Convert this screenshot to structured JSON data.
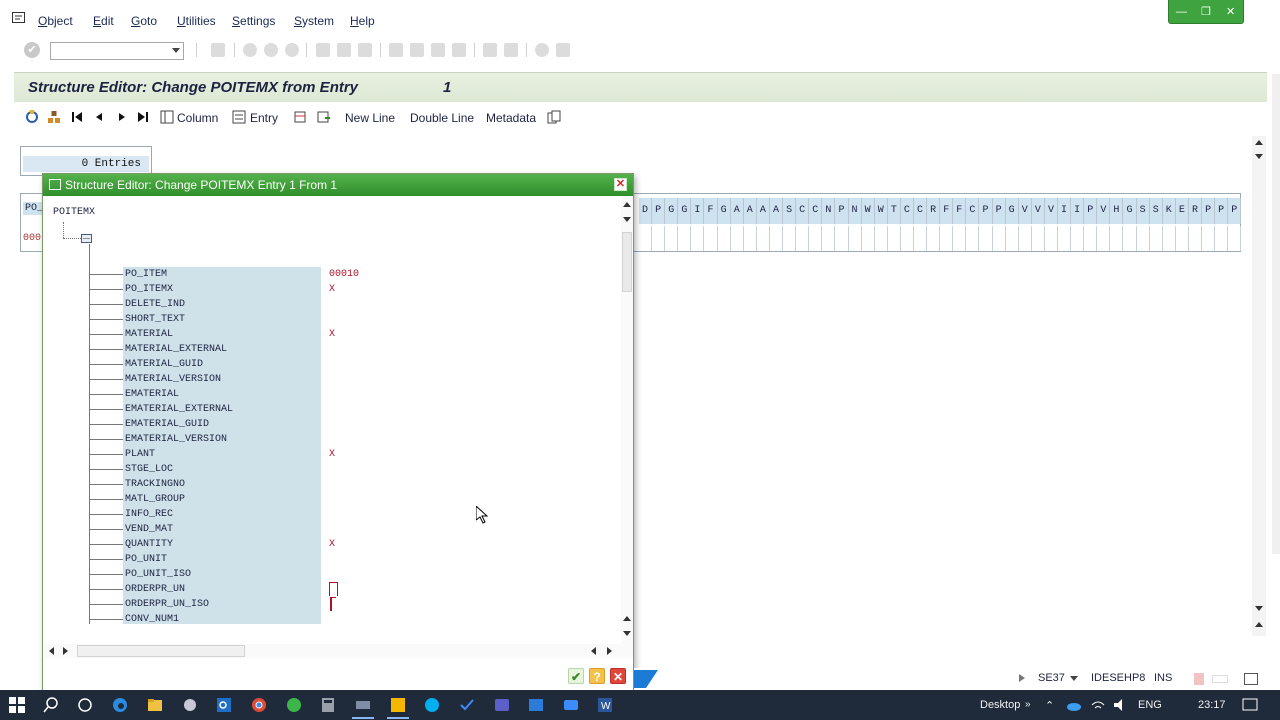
{
  "menu": {
    "items": [
      "Object",
      "Edit",
      "Goto",
      "Utilities",
      "Settings",
      "System",
      "Help"
    ]
  },
  "screen": {
    "title": "Structure Editor: Change POITEMX from Entry",
    "entry_number": "1"
  },
  "app_toolbar": {
    "column_label": "Column",
    "entry_label": "Entry",
    "new_line_label": "New Line",
    "double_line_label": "Double Line",
    "metadata_label": "Metadata"
  },
  "background_table": {
    "entries_text": "0 Entries",
    "first_header_fragment": "PO_",
    "first_value_fragment": "000",
    "column_letters": [
      "D",
      "P",
      "G",
      "G",
      "I",
      "F",
      "G",
      "A",
      "A",
      "A",
      "A",
      "S",
      "C",
      "C",
      "N",
      "P",
      "N",
      "W",
      "W",
      "T",
      "C",
      "C",
      "R",
      "F",
      "F",
      "C",
      "P",
      "P",
      "G",
      "V",
      "V",
      "V",
      "I",
      "I",
      "P",
      "V",
      "H",
      "G",
      "S",
      "S",
      "K",
      "E",
      "R",
      "P",
      "P",
      "P"
    ]
  },
  "dialog": {
    "title": "Structure Editor: Change POITEMX Entry 1 From 1",
    "root_label": "POITEMX",
    "fields": [
      {
        "name": "PO_ITEM",
        "value": "00010"
      },
      {
        "name": "PO_ITEMX",
        "value": "X"
      },
      {
        "name": "DELETE_IND",
        "value": ""
      },
      {
        "name": "SHORT_TEXT",
        "value": ""
      },
      {
        "name": "MATERIAL",
        "value": "X"
      },
      {
        "name": "MATERIAL_EXTERNAL",
        "value": ""
      },
      {
        "name": "MATERIAL_GUID",
        "value": ""
      },
      {
        "name": "MATERIAL_VERSION",
        "value": ""
      },
      {
        "name": "EMATERIAL",
        "value": ""
      },
      {
        "name": "EMATERIAL_EXTERNAL",
        "value": ""
      },
      {
        "name": "EMATERIAL_GUID",
        "value": ""
      },
      {
        "name": "EMATERIAL_VERSION",
        "value": ""
      },
      {
        "name": "PLANT",
        "value": "X"
      },
      {
        "name": "STGE_LOC",
        "value": ""
      },
      {
        "name": "TRACKINGNO",
        "value": ""
      },
      {
        "name": "MATL_GROUP",
        "value": ""
      },
      {
        "name": "INFO_REC",
        "value": ""
      },
      {
        "name": "VEND_MAT",
        "value": ""
      },
      {
        "name": "QUANTITY",
        "value": "X"
      },
      {
        "name": "PO_UNIT",
        "value": ""
      },
      {
        "name": "PO_UNIT_ISO",
        "value": ""
      },
      {
        "name": "ORDERPR_UN",
        "value": ""
      },
      {
        "name": "ORDERPR_UN_ISO",
        "value": ""
      },
      {
        "name": "CONV_NUM1",
        "value": ""
      }
    ]
  },
  "status": {
    "transaction": "SE37",
    "system": "IDESEHP8",
    "mode": "INS"
  },
  "taskbar": {
    "desktop_label": "Desktop",
    "language": "ENG",
    "time": "23:17"
  },
  "colors": {
    "dialog_title_green": "#3f9f3a",
    "field_name_bg": "#cfe2ea",
    "field_value_red": "#b0102a",
    "title_text": "#1d2240"
  }
}
